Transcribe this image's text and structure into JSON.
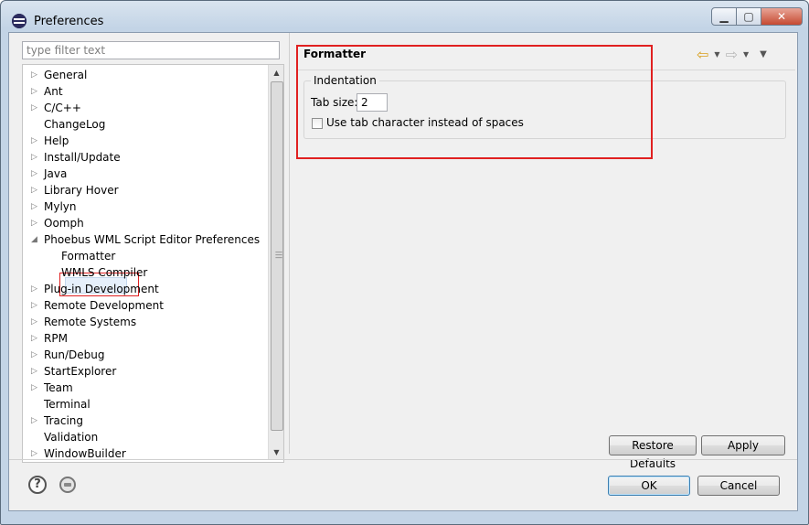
{
  "window": {
    "title": "Preferences"
  },
  "filter": {
    "placeholder": "type filter text"
  },
  "tree": {
    "items": [
      {
        "label": "General",
        "expandable": true,
        "level": 0
      },
      {
        "label": "Ant",
        "expandable": true,
        "level": 0
      },
      {
        "label": "C/C++",
        "expandable": true,
        "level": 0
      },
      {
        "label": "ChangeLog",
        "expandable": false,
        "level": 0
      },
      {
        "label": "Help",
        "expandable": true,
        "level": 0
      },
      {
        "label": "Install/Update",
        "expandable": true,
        "level": 0
      },
      {
        "label": "Java",
        "expandable": true,
        "level": 0
      },
      {
        "label": "Library Hover",
        "expandable": true,
        "level": 0
      },
      {
        "label": "Mylyn",
        "expandable": true,
        "level": 0
      },
      {
        "label": "Oomph",
        "expandable": true,
        "level": 0
      },
      {
        "label": "Phoebus WML Script Editor Preferences",
        "expandable": true,
        "expanded": true,
        "level": 0
      },
      {
        "label": "Formatter",
        "expandable": false,
        "level": 1,
        "selected": true
      },
      {
        "label": "WMLS Compiler",
        "expandable": false,
        "level": 1
      },
      {
        "label": "Plug-in Development",
        "expandable": true,
        "level": 0
      },
      {
        "label": "Remote Development",
        "expandable": true,
        "level": 0
      },
      {
        "label": "Remote Systems",
        "expandable": true,
        "level": 0
      },
      {
        "label": "RPM",
        "expandable": true,
        "level": 0
      },
      {
        "label": "Run/Debug",
        "expandable": true,
        "level": 0
      },
      {
        "label": "StartExplorer",
        "expandable": true,
        "level": 0
      },
      {
        "label": "Team",
        "expandable": true,
        "level": 0
      },
      {
        "label": "Terminal",
        "expandable": false,
        "level": 0
      },
      {
        "label": "Tracing",
        "expandable": true,
        "level": 0
      },
      {
        "label": "Validation",
        "expandable": false,
        "level": 0
      },
      {
        "label": "WindowBuilder",
        "expandable": true,
        "level": 0
      }
    ]
  },
  "page": {
    "title": "Formatter",
    "indentation": {
      "group_label": "Indentation",
      "tab_size_label": "Tab size:",
      "tab_size_value": "2",
      "use_tab_label": "Use tab character instead of spaces",
      "use_tab_checked": false
    }
  },
  "buttons": {
    "restore_defaults": "Restore Defaults",
    "apply": "Apply",
    "ok": "OK",
    "cancel": "Cancel"
  },
  "colors": {
    "highlight": "#e02020",
    "nav_back": "#d8a020"
  }
}
